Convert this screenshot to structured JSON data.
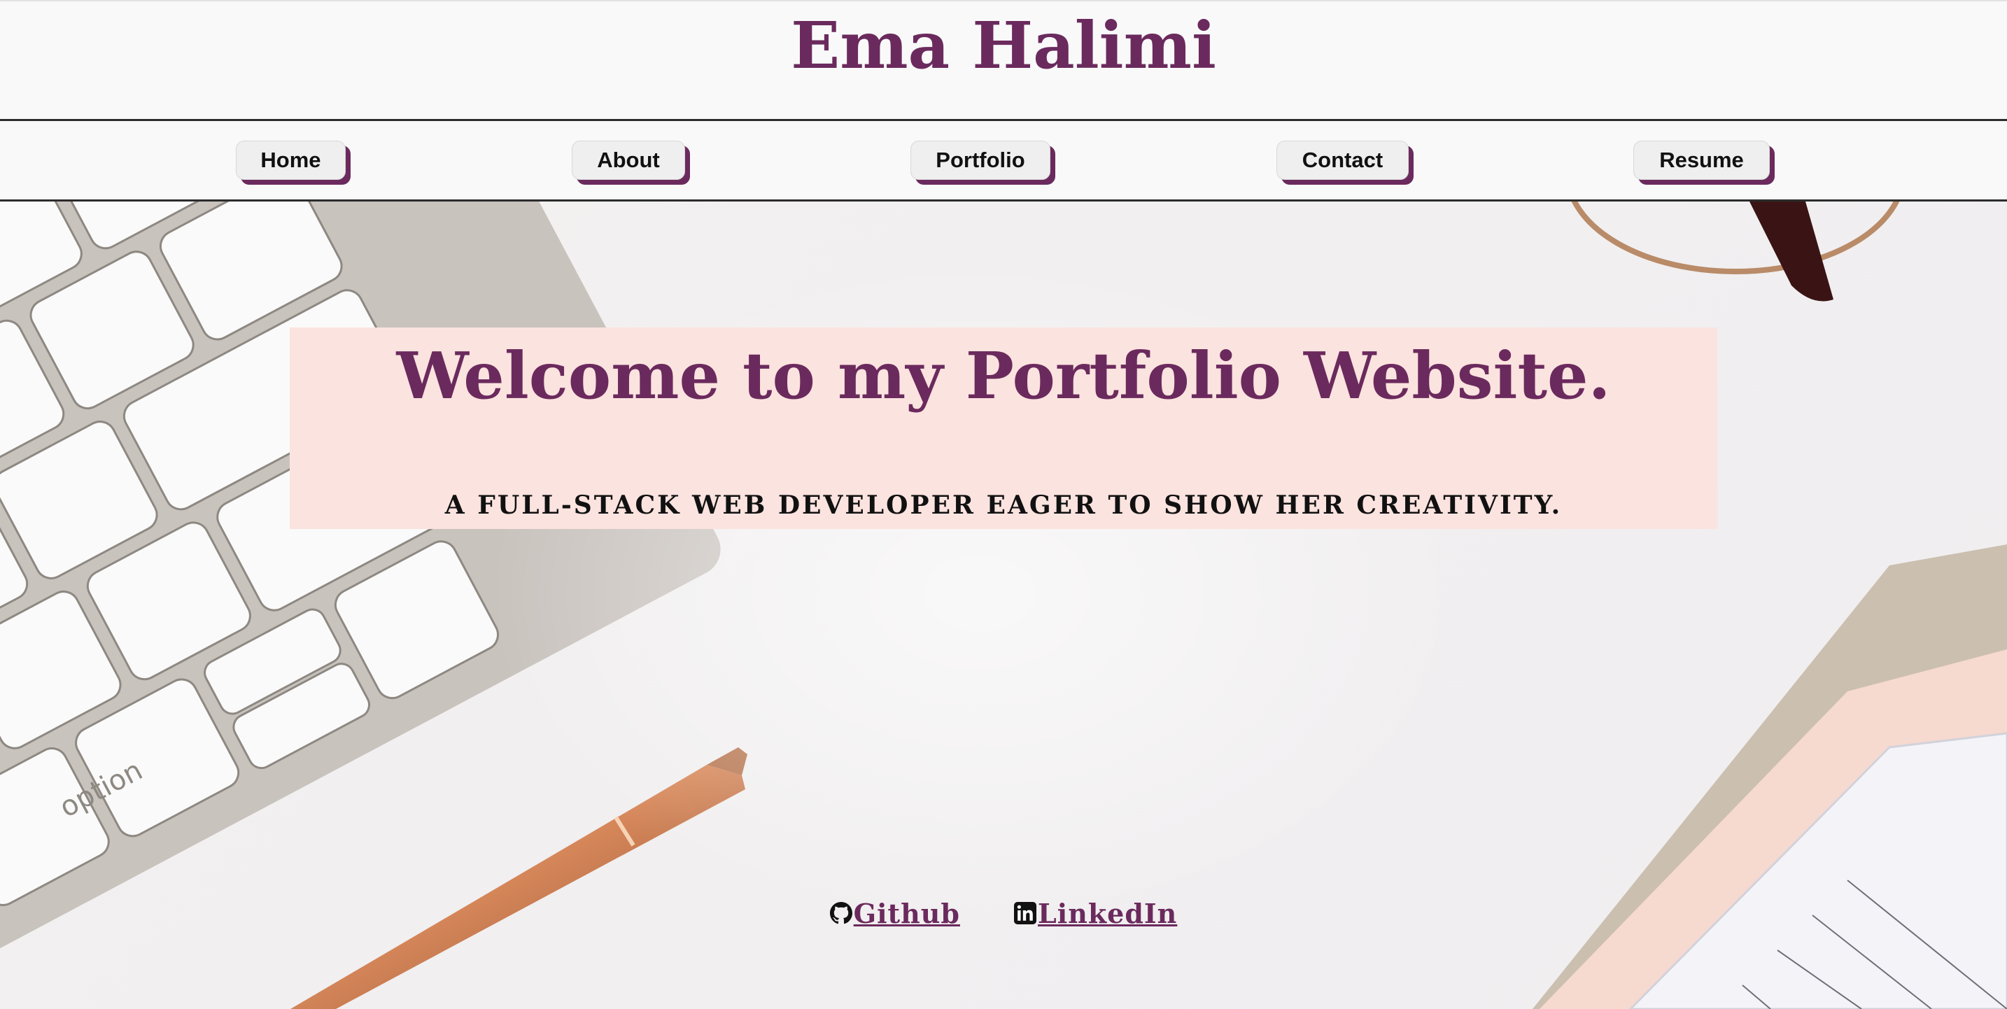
{
  "site": {
    "title": "Ema Halimi"
  },
  "nav": {
    "items": [
      {
        "label": "Home"
      },
      {
        "label": "About"
      },
      {
        "label": "Portfolio"
      },
      {
        "label": "Contact"
      },
      {
        "label": "Resume"
      }
    ]
  },
  "hero": {
    "heading": "Welcome to my Portfolio Website.",
    "subheading": "A FULL-STACK WEB DEVELOPER EAGER TO SHOW HER CREATIVITY."
  },
  "social": {
    "github": {
      "label": "Github",
      "icon": "github-icon"
    },
    "linkedin": {
      "label": "LinkedIn",
      "icon": "linkedin-icon"
    }
  },
  "colors": {
    "accent": "#6b2a5d",
    "welcome_bg": "#fbe3df",
    "nav_button_bg": "#efefef"
  }
}
